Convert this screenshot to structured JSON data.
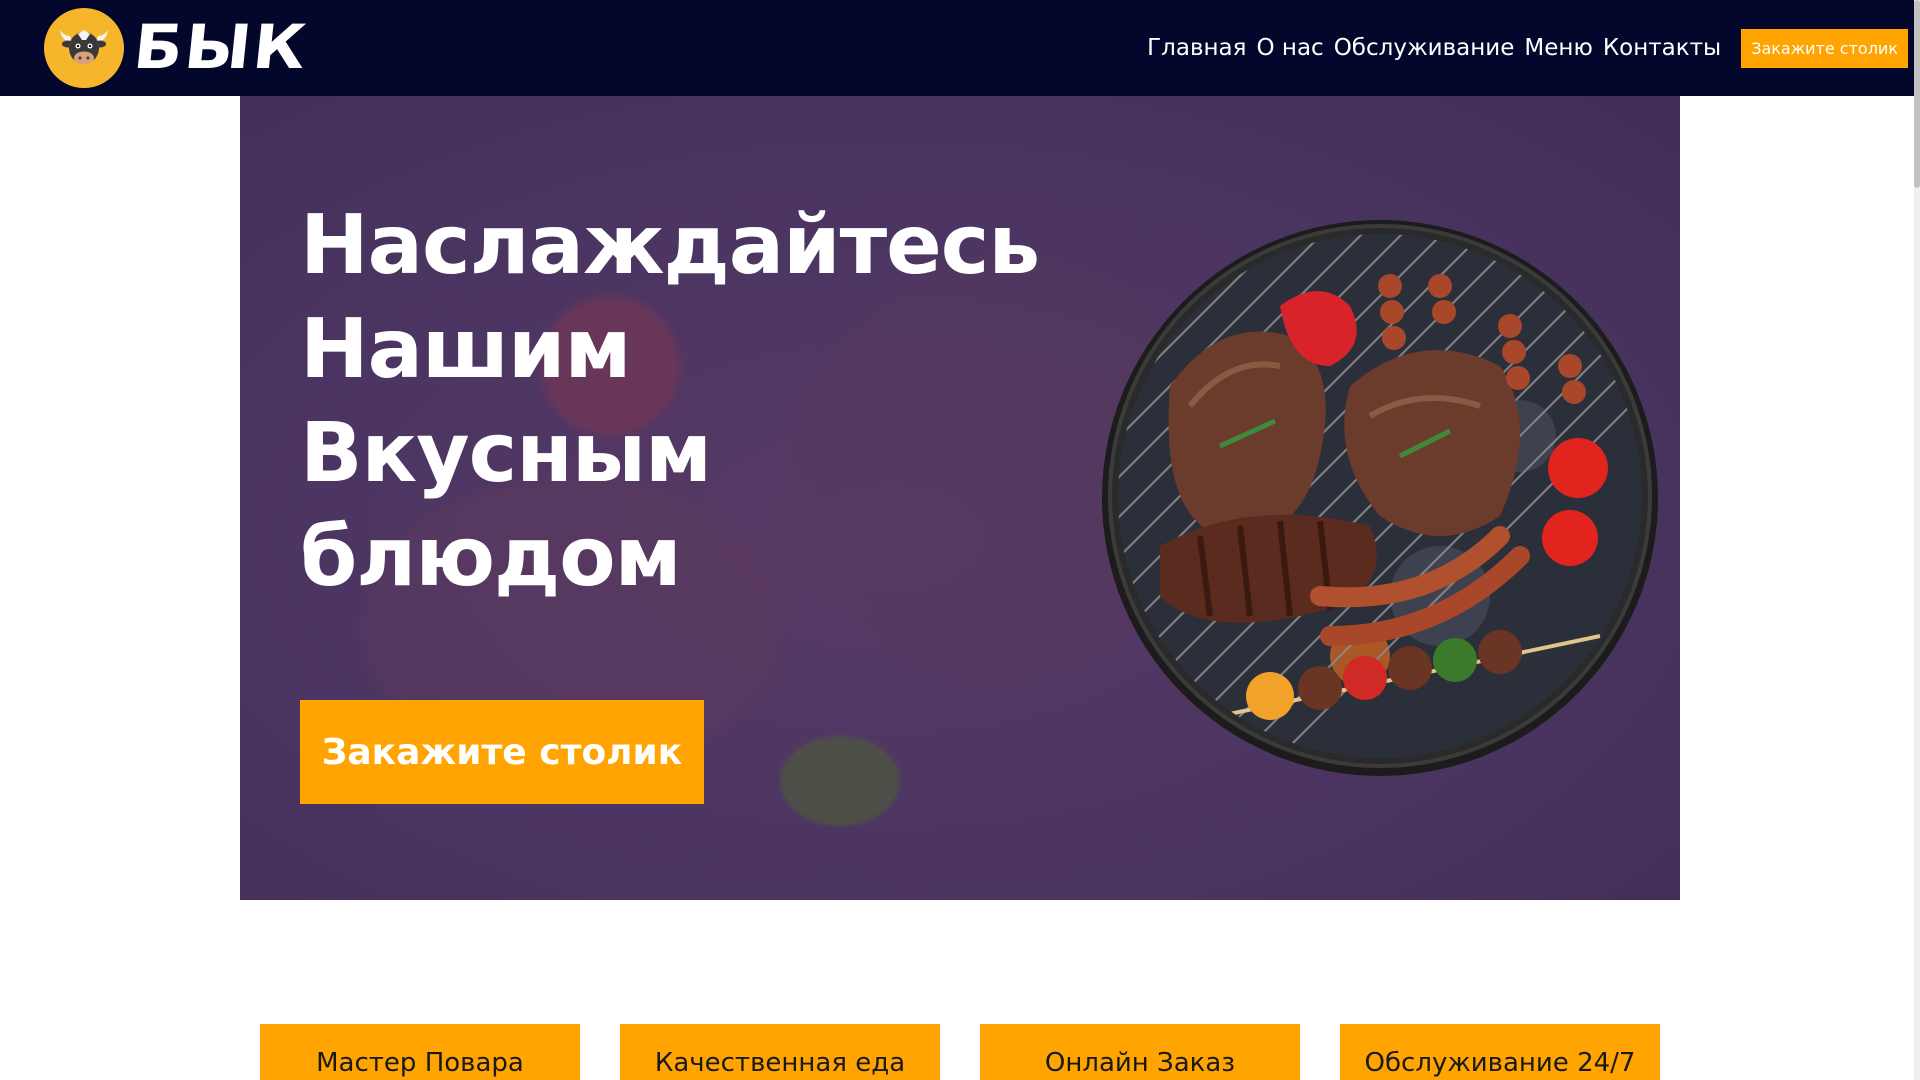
{
  "brand": {
    "name": "БЫК",
    "logo_icon": "bull-head-icon"
  },
  "nav": {
    "links": [
      "Главная",
      "О нас",
      "Обслуживание",
      "Меню",
      "Контакты"
    ],
    "cta_label": "Закажите столик"
  },
  "hero": {
    "title_lines": [
      "Наслаждайтесь",
      "Нашим",
      "Вкусным",
      "блюдом"
    ],
    "button_label": "Закажите столик",
    "image_icon": "grill-food-icon"
  },
  "features": [
    {
      "label": "Мастер Повара"
    },
    {
      "label": "Качественная еда"
    },
    {
      "label": "Онлайн Заказ"
    },
    {
      "label": "Обслуживание 24/7"
    }
  ],
  "colors": {
    "navbar_bg": "#04072c",
    "accent": "#ffa400",
    "hero_overlay": "#4e3663",
    "logo_bg": "#f5b62b"
  }
}
